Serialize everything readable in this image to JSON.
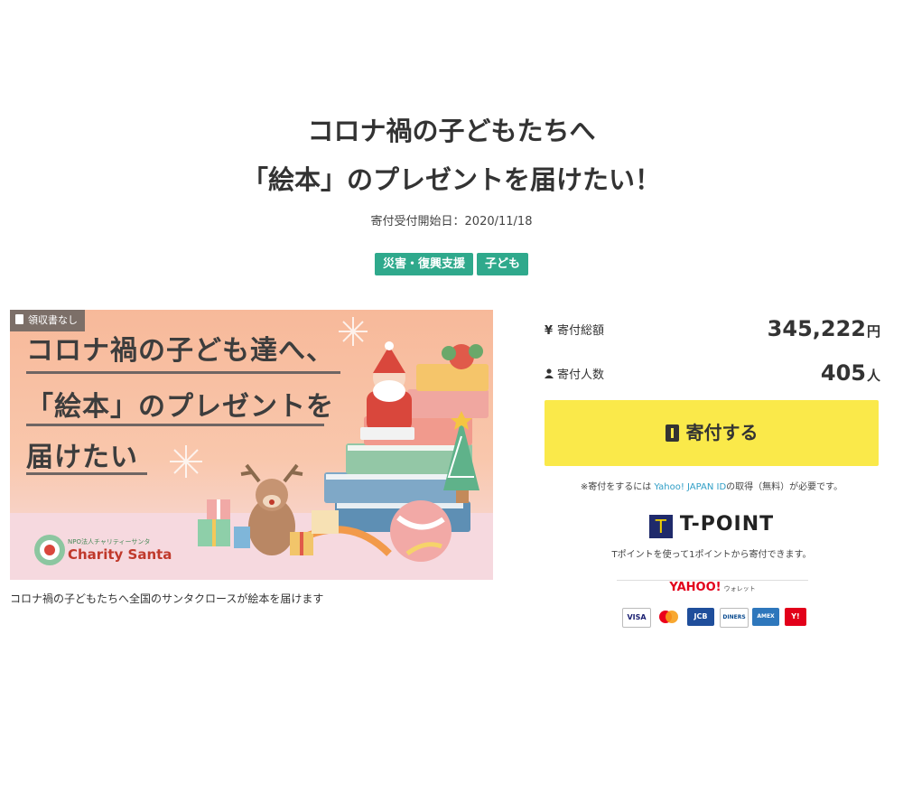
{
  "title_line1": "コロナ禍の子どもたちへ",
  "title_line2": "「絵本」のプレゼントを届けたい！",
  "start_date_text": "寄付受付開始日：2020/11/18",
  "tags": [
    "災害・復興支援",
    "子ども"
  ],
  "banner": {
    "receipt_badge": "領収書なし",
    "headline_line1": "コロナ禍の子ども達へ、",
    "headline_line2": "「絵本」のプレゼントを",
    "headline_line3": "届けたい",
    "logo_small": "NPO法人チャリティーサンタ",
    "logo_name": "Charity Santa"
  },
  "caption": "コロナ禍の子どもたちへ全国のサンタクロースが絵本を届けます",
  "stats": {
    "total_label": "寄付総額",
    "total_icon": "¥",
    "total_value": "345,222",
    "total_unit": "円",
    "people_label": "寄付人数",
    "people_value": "405",
    "people_unit": "人"
  },
  "donate_button": "寄付する",
  "notice_before": "※寄付をするには ",
  "notice_link": "Yahoo! JAPAN ID",
  "notice_after": "の取得（無料）が必要です。",
  "tpoint_logo": "T-POINT",
  "tpoint_mark": "T",
  "tpoint_desc": "Tポイントを使って1ポイントから寄付できます。",
  "wallet_title": "YAHOO!",
  "wallet_sub": "ウォレット",
  "cards": [
    "VISA",
    "MC",
    "JCB",
    "DINERS",
    "AMEX",
    "Y!"
  ],
  "colors": {
    "tag_green": "#2fa98c",
    "button_yellow": "#fae94a",
    "link_blue": "#2f9ec6",
    "banner_peach": "#f7b99a"
  }
}
